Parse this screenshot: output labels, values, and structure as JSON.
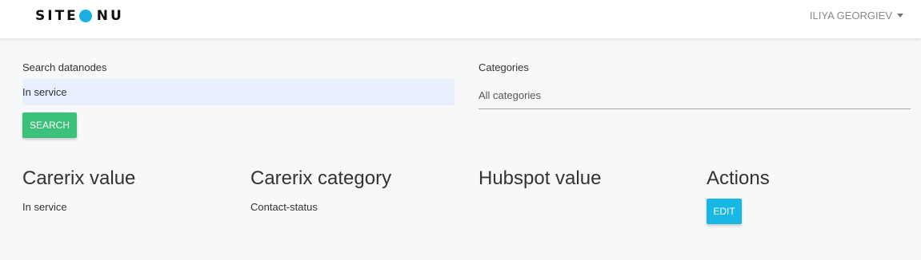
{
  "header": {
    "logo_left": "SITE",
    "logo_right": "NU",
    "user_name": "ILIYA GEORGIEV"
  },
  "search": {
    "label": "Search datanodes",
    "value": "In service",
    "button_label": "SEARCH"
  },
  "categories": {
    "label": "Categories",
    "selected": "All categories"
  },
  "table": {
    "headers": [
      "Carerix value",
      "Carerix category",
      "Hubspot value",
      "Actions"
    ],
    "rows": [
      {
        "carerix_value": "In service",
        "carerix_category": "Contact-status",
        "hubspot_value": "",
        "action_label": "EDIT"
      }
    ]
  },
  "colors": {
    "accent": "#1aaee5",
    "search_button": "#3cc17a",
    "edit_button": "#17b8e4"
  }
}
